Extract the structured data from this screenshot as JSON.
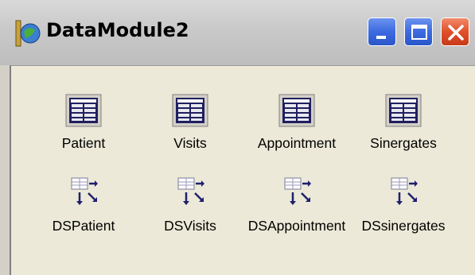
{
  "window": {
    "title": "DataModule2",
    "icon": "datamodule-icon",
    "controls": {
      "minimize": "minimize-icon",
      "maximize": "maximize-icon",
      "close": "close-icon"
    }
  },
  "components": [
    {
      "label": "Patient",
      "icon": "table-icon"
    },
    {
      "label": "Visits",
      "icon": "table-icon"
    },
    {
      "label": "Appointment",
      "icon": "table-icon"
    },
    {
      "label": "Sinergates",
      "icon": "table-icon"
    },
    {
      "label": "DSPatient",
      "icon": "datasource-icon"
    },
    {
      "label": "DSVisits",
      "icon": "datasource-icon"
    },
    {
      "label": "DSAppointment",
      "icon": "datasource-icon"
    },
    {
      "label": "DSsinergates",
      "icon": "datasource-icon"
    }
  ]
}
